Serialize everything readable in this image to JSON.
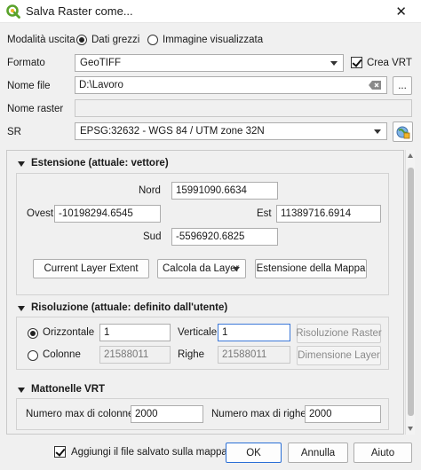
{
  "window": {
    "title": "Salva Raster come...",
    "close_glyph": "✕"
  },
  "colors": {
    "accent": "#3c78d8",
    "qgis_green": "#5aa22b"
  },
  "output_mode": {
    "label": "Modalità uscita",
    "option_raw": "Dati grezzi",
    "option_rendered": "Immagine visualizzata",
    "selected": "Dati grezzi"
  },
  "format": {
    "label": "Formato",
    "value": "GeoTIFF",
    "create_vrt_label": "Crea VRT",
    "create_vrt_checked": true
  },
  "file_name": {
    "label": "Nome file",
    "value": "D:\\Lavoro",
    "browse_label": "..."
  },
  "raster_name": {
    "label": "Nome raster",
    "value": ""
  },
  "crs": {
    "label": "SR",
    "value": "EPSG:32632 - WGS 84 / UTM zone 32N"
  },
  "extent": {
    "title": "Estensione (attuale: vettore)",
    "north_label": "Nord",
    "north": "15991090.6634",
    "west_label": "Ovest",
    "west": "-10198294.6545",
    "east_label": "Est",
    "east": "11389716.6914",
    "south_label": "Sud",
    "south": "-5596920.6825",
    "current_layer_btn": "Current Layer Extent",
    "calc_from_layer_btn": "Calcola da Layer",
    "map_extent_btn": "Estensione della Mappa"
  },
  "resolution": {
    "title": "Risoluzione (attuale: definito dall'utente)",
    "horizontal_label": "Orizzontale",
    "horizontal": "1",
    "vertical_label": "Verticale",
    "vertical": "1",
    "raster_res_btn": "Risoluzione Raster",
    "columns_label": "Colonne",
    "columns": "21588011",
    "rows_label": "Righe",
    "rows": "21588011",
    "layer_size_btn": "Dimensione Layer"
  },
  "vrt_tiles": {
    "title": "Mattonelle VRT",
    "max_columns_label": "Numero max di colonne",
    "max_columns": "2000",
    "max_rows_label": "Numero max di righe",
    "max_rows": "2000"
  },
  "footer": {
    "add_to_map_label": "Aggiungi il file salvato sulla mappa",
    "add_to_map_checked": true,
    "ok": "OK",
    "cancel": "Annulla",
    "help": "Aiuto"
  },
  "icons": {
    "app": "qgis-logo-icon",
    "clear": "clear-field-icon",
    "crs_selector": "globe-crs-icon",
    "dropdown": "chevron-down-icon",
    "collapse": "collapse-triangle-icon"
  }
}
